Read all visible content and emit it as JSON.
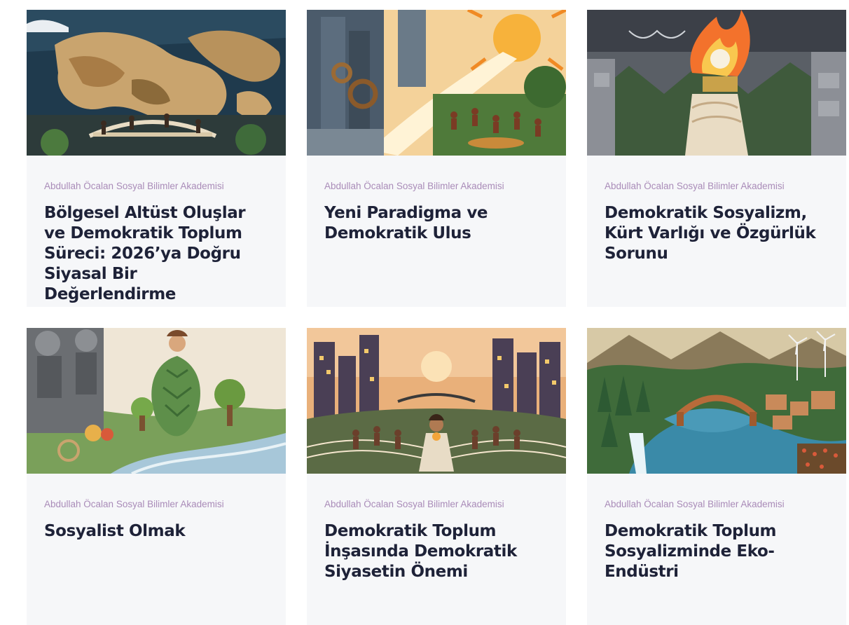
{
  "articles": [
    {
      "category": "Abdullah Öcalan Sosyal Bilimler Akademisi",
      "title": "Bölgesel Altüst Oluşlar ve Demokratik Toplum Süreci: 2026’ya Doğru Siyasal Bir Değerlendirme",
      "image_icon": "map-bridge-illustration"
    },
    {
      "category": "Abdullah Öcalan Sosyal Bilimler Akademisi",
      "title": "Yeni Paradigma ve Demokratik Ulus",
      "image_icon": "sun-gears-community-illustration"
    },
    {
      "category": "Abdullah Öcalan Sosyal Bilimler Akademisi",
      "title": "Demokratik Sosyalizm, Kürt Varlığı ve Özgürlük Sorunu",
      "image_icon": "torch-hand-illustration"
    },
    {
      "category": "Abdullah Öcalan Sosyal Bilimler Akademisi",
      "title": "Sosyalist Olmak",
      "image_icon": "nature-figures-illustration"
    },
    {
      "category": "Abdullah Öcalan Sosyal Bilimler Akademisi",
      "title": "Demokratik Toplum İnşasında Demokratik Siyasetin Önemi",
      "image_icon": "city-crowd-illustration"
    },
    {
      "category": "Abdullah Öcalan Sosyal Bilimler Akademisi",
      "title": "Demokratik Toplum Sosyalizminde Eko-Endüstri",
      "image_icon": "river-windmills-illustration"
    }
  ],
  "colors": {
    "card_background": "#f6f7f9",
    "category_text": "#a98bb8",
    "title_text": "#1e2238"
  }
}
